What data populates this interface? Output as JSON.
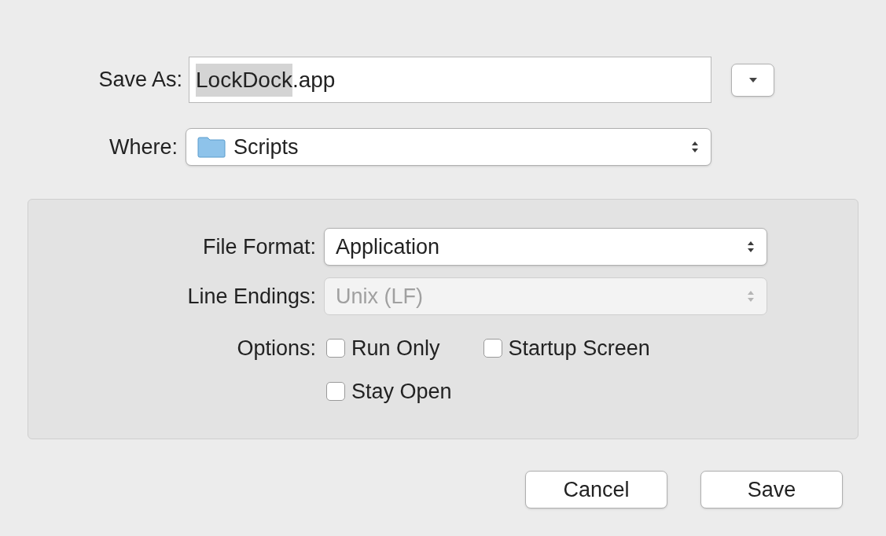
{
  "save_as": {
    "label": "Save As:",
    "value_parts": [
      {
        "text": "LockDock",
        "selected": true
      },
      {
        "text": ".app",
        "selected": false
      }
    ]
  },
  "where": {
    "label": "Where:",
    "value": "Scripts"
  },
  "options_panel": {
    "fields": [
      {
        "kind": "popup",
        "label": "File Format:",
        "value": "Application",
        "disabled": false
      },
      {
        "kind": "popup",
        "label": "Line Endings:",
        "value": "Unix (LF)",
        "disabled": true
      }
    ],
    "options_label": "Options:",
    "options": [
      {
        "label": "Run Only",
        "checked": false
      },
      {
        "label": "Startup Screen",
        "checked": false
      },
      {
        "label": "Stay Open",
        "checked": false
      }
    ]
  },
  "buttons": [
    {
      "label": "Cancel"
    },
    {
      "label": "Save"
    }
  ]
}
